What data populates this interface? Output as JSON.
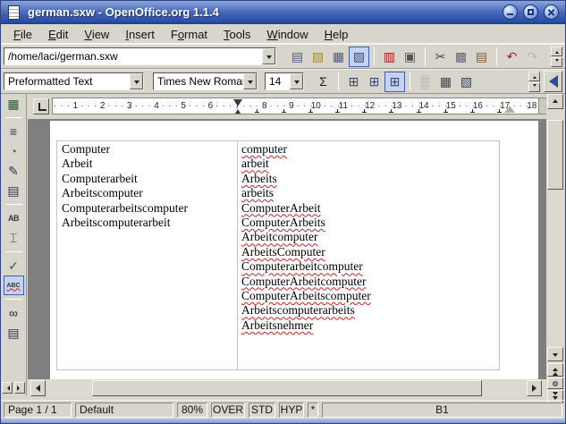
{
  "window": {
    "title": "german.sxw - OpenOffice.org 1.1.4"
  },
  "colors": {
    "titlebar_top": "#8aa3dc",
    "titlebar_bottom": "#27479e",
    "pressed_bg": "#c3d3f0",
    "spell_underline": "#cc2222",
    "window_bg": "#d8d6cc"
  },
  "menu": {
    "items": [
      {
        "name": "menu-file",
        "pre": "",
        "key": "F",
        "post": "ile"
      },
      {
        "name": "menu-edit",
        "pre": "",
        "key": "E",
        "post": "dit"
      },
      {
        "name": "menu-view",
        "pre": "",
        "key": "V",
        "post": "iew"
      },
      {
        "name": "menu-insert",
        "pre": "",
        "key": "I",
        "post": "nsert"
      },
      {
        "name": "menu-format",
        "pre": "F",
        "key": "o",
        "post": "rmat"
      },
      {
        "name": "menu-tools",
        "pre": "",
        "key": "T",
        "post": "ools"
      },
      {
        "name": "menu-window",
        "pre": "",
        "key": "W",
        "post": "indow"
      },
      {
        "name": "menu-help",
        "pre": "",
        "key": "H",
        "post": "elp"
      }
    ]
  },
  "toolbar_main": {
    "url_value": "/home/laci/german.sxw",
    "icons": [
      {
        "name": "new-document-icon",
        "glyph": "▤",
        "color": "#4a5a8a"
      },
      {
        "name": "open-icon",
        "glyph": "▨",
        "color": "#a8892c"
      },
      {
        "name": "save-icon",
        "glyph": "▦",
        "color": "#4a5a8a"
      },
      {
        "name": "edit-file-icon",
        "glyph": "▧",
        "color": "#3a4a7a",
        "pressed": true
      },
      {
        "sep": true
      },
      {
        "name": "export-pdf-icon",
        "glyph": "▥",
        "color": "#a02020"
      },
      {
        "name": "print-icon",
        "glyph": "▣",
        "color": "#55584e"
      },
      {
        "sep": true
      },
      {
        "name": "cut-icon",
        "glyph": "✂",
        "color": "#444444"
      },
      {
        "name": "copy-icon",
        "glyph": "▩",
        "color": "#667"
      },
      {
        "name": "paste-icon",
        "glyph": "▤",
        "color": "#875c2c"
      },
      {
        "sep": true
      },
      {
        "name": "undo-icon",
        "glyph": "↶",
        "color": "#8a2a2a"
      },
      {
        "name": "redo-icon",
        "glyph": "↷",
        "color": "#9a9a92",
        "cls": "disabled"
      }
    ]
  },
  "toolbar_object": {
    "style_value": "Preformatted Text",
    "font_value": "Times New Roman",
    "size_value": "14",
    "icons": [
      {
        "name": "sum-icon",
        "glyph": "Σ",
        "color": "#222222"
      },
      {
        "sep": true
      },
      {
        "name": "optimal-column-width-icon",
        "glyph": "⊞",
        "color": "#344a7a"
      },
      {
        "name": "space-columns-equally-icon",
        "glyph": "⊞",
        "color": "#344a7a"
      },
      {
        "name": "column-width-icon",
        "glyph": "⊞",
        "color": "#344a7a",
        "pressed": true
      },
      {
        "sep": true
      },
      {
        "name": "background-color-icon",
        "glyph": "▒",
        "color": "#9aa4a4"
      },
      {
        "name": "borders-icon",
        "glyph": "▦",
        "color": "#334455"
      },
      {
        "name": "border-style-icon",
        "glyph": "▧",
        "color": "#334455"
      }
    ]
  },
  "main_toolbar_vertical": {
    "icons": [
      {
        "name": "insert-table-icon",
        "glyph": "▦",
        "color": "#2a5a2a"
      },
      {
        "sep": true
      },
      {
        "name": "insert-fields-icon",
        "glyph": "≡",
        "color": "#333344"
      },
      {
        "name": "insert-object-icon",
        "glyph": "◔",
        "color": "#8a5a2a"
      },
      {
        "name": "draw-functions-icon",
        "glyph": "✎",
        "color": "#333355"
      },
      {
        "name": "form-functions-icon",
        "glyph": "▤",
        "color": "#333355"
      },
      {
        "sep": true
      },
      {
        "name": "autotext-icon",
        "glyph": "AB",
        "color": "#333333",
        "cls": "txt-sm"
      },
      {
        "name": "direct-cursor-icon",
        "glyph": "⌶",
        "color": "#333333"
      },
      {
        "sep": true
      },
      {
        "name": "spellcheck-icon",
        "glyph": "✓",
        "color": "#2a6a2a"
      },
      {
        "name": "autospellcheck-icon",
        "glyph": "ABC",
        "color": "#333333",
        "cls": "txt-wavy",
        "pressed": true
      },
      {
        "sep": true
      },
      {
        "name": "find-replace-icon",
        "glyph": "∞",
        "color": "#222222"
      },
      {
        "name": "data-sources-icon",
        "glyph": "▤",
        "color": "#333355"
      }
    ]
  },
  "ruler": {
    "numbers": [
      "1",
      "2",
      "3",
      "4",
      "5",
      "6",
      "7",
      "8",
      "9",
      "10",
      "11",
      "12",
      "13",
      "14",
      "15",
      "16",
      "17",
      "18"
    ]
  },
  "document": {
    "table": {
      "left_lines": [
        "Computer",
        "Arbeit",
        "Computerarbeit",
        "Arbeitscomputer",
        "Computerarbeitscomputer",
        "Arbeitscomputerarbeit"
      ],
      "right_lines": [
        "computer",
        "arbeit",
        "Arbeits",
        "arbeits",
        "ComputerArbeit",
        "ComputerArbeits",
        "Arbeitcomputer",
        "ArbeitsComputer",
        "Computerarbeitcomputer",
        "ComputerArbeitcomputer",
        "ComputerArbeitscomputer",
        "Arbeitscomputerarbeits",
        "Arbeitsnehmer"
      ]
    }
  },
  "statusbar": {
    "page": "Page 1 / 1",
    "template": "Default",
    "zoom": "80%",
    "insert_mode": "OVER",
    "selection_mode": "STD",
    "hyperlink_mode": "HYP",
    "modified": "*",
    "field": "B1"
  }
}
